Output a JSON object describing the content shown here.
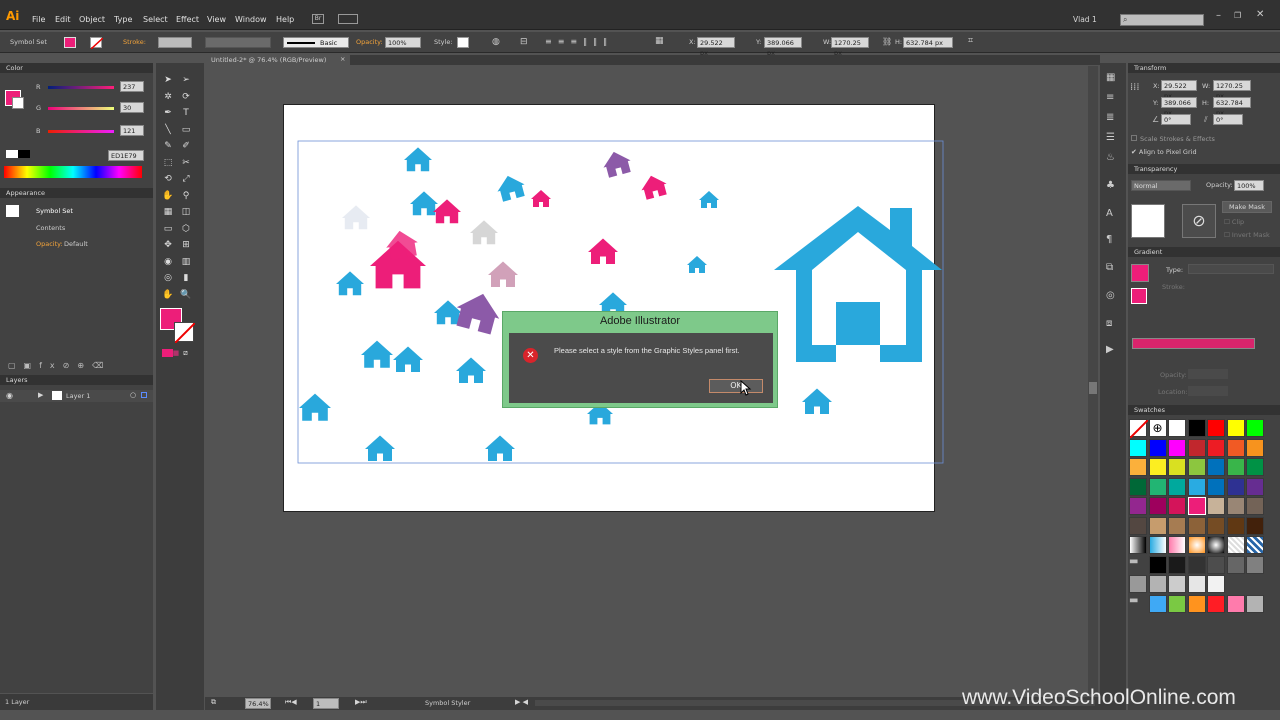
{
  "app": {
    "logo": "Ai",
    "menus": [
      "File",
      "Edit",
      "Object",
      "Type",
      "Select",
      "Effect",
      "View",
      "Window",
      "Help"
    ],
    "user": "Vlad 1",
    "search_placeholder": ""
  },
  "control": {
    "selection_type": "Symbol Set",
    "stroke_label": "Stroke:",
    "brush_label": "Basic",
    "opacity_label": "Opacity:",
    "opacity_value": "100%",
    "style_label": "Style:",
    "x_label": "X:",
    "x": "29.522 px",
    "y_label": "Y:",
    "y": "389.066 px",
    "w_label": "W:",
    "w": "1270.25 px",
    "h_label": "H:",
    "h": "632.784 px"
  },
  "document": {
    "tab_title": "Untitled-2* @ 76.4% (RGB/Preview)",
    "tab_close": "×"
  },
  "color_panel": {
    "title": "Color",
    "r_label": "R",
    "g_label": "G",
    "b_label": "B",
    "r": "237",
    "g": "30",
    "b": "121",
    "hex": "ED1E79"
  },
  "appearance_panel": {
    "title": "Appearance",
    "item_title": "Symbol Set",
    "contents": "Contents",
    "opacity_label": "Opacity:",
    "opacity_value": "Default"
  },
  "layers_panel": {
    "title": "Layers",
    "layer_name": "Layer 1",
    "footer": "1 Layer"
  },
  "transform_panel": {
    "title": "Transform",
    "x_label": "X:",
    "x": "29.522 px",
    "y_label": "Y:",
    "y": "389.066 px",
    "w_label": "W:",
    "w": "1270.25 px",
    "h_label": "H:",
    "h": "632.784 px",
    "angle": "0°",
    "shear": "0°",
    "scale_strokes": "Scale Strokes & Effects",
    "align_pixel": "Align to Pixel Grid"
  },
  "transparency_panel": {
    "title": "Transparency",
    "mode": "Normal",
    "opacity_label": "Opacity:",
    "opacity": "100%",
    "make_mask": "Make Mask",
    "clip": "Clip",
    "invert": "Invert Mask"
  },
  "gradient_panel": {
    "title": "Gradient",
    "type_label": "Type:",
    "stroke_label": "Stroke:",
    "opacity_label": "Opacity:",
    "location_label": "Location:"
  },
  "swatches_panel": {
    "title": "Swatches"
  },
  "status": {
    "zoom": "76.4%",
    "page": "1",
    "tool_name": "Symbol Styler"
  },
  "dialog": {
    "title": "Adobe Illustrator",
    "message": "Please select a style from the Graphic Styles panel first.",
    "ok": "OK"
  },
  "watermark": "www.VideoSchoolOnline.com",
  "colors": {
    "accent_pink": "#ED1E79",
    "house_blue": "#29a8dc",
    "house_purple": "#8c5aa8",
    "dialog_green": "#7ec98a"
  },
  "swatch_rows": [
    [
      "none",
      "reg",
      "#ffffff",
      "#000000",
      "#ff0000",
      "#ffff00",
      "#00ff00"
    ],
    [
      "#00ffff",
      "#0000ff",
      "#ff00ff",
      "#c1272d",
      "#ed1c24",
      "#f15a24",
      "#f7931e"
    ],
    [
      "#fbb03b",
      "#fcee21",
      "#d9e021",
      "#8cc63f",
      "#0071bc",
      "#39b54a",
      "#009245"
    ],
    [
      "#006837",
      "#22b573",
      "#00a99d",
      "#29abe2",
      "#0071bc",
      "#2e3192",
      "#662d91"
    ],
    [
      "#93278f",
      "#9e005d",
      "#d4145a",
      "#ed1e79",
      "#c7b299",
      "#998675",
      "#736357"
    ],
    [
      "#534741",
      "#c69c6d",
      "#a67c52",
      "#8c6239",
      "#754c24",
      "#603813",
      "#42210b"
    ],
    [
      "grad1",
      "grad2",
      "grad3",
      "grad4",
      "grad5",
      "pat1",
      "pat2"
    ],
    [
      "folder",
      "#000000",
      "#1a1a1a",
      "#333333",
      "#4d4d4d",
      "#666666",
      "#808080"
    ],
    [
      "#999999",
      "#b3b3b3",
      "#cccccc",
      "#e6e6e6",
      "#f2f2f2",
      "",
      ""
    ],
    [
      "folder",
      "#3fa9f5",
      "#7ac943",
      "#ff931e",
      "#ff1d25",
      "#ff7bac",
      "#b3b3b3"
    ]
  ]
}
